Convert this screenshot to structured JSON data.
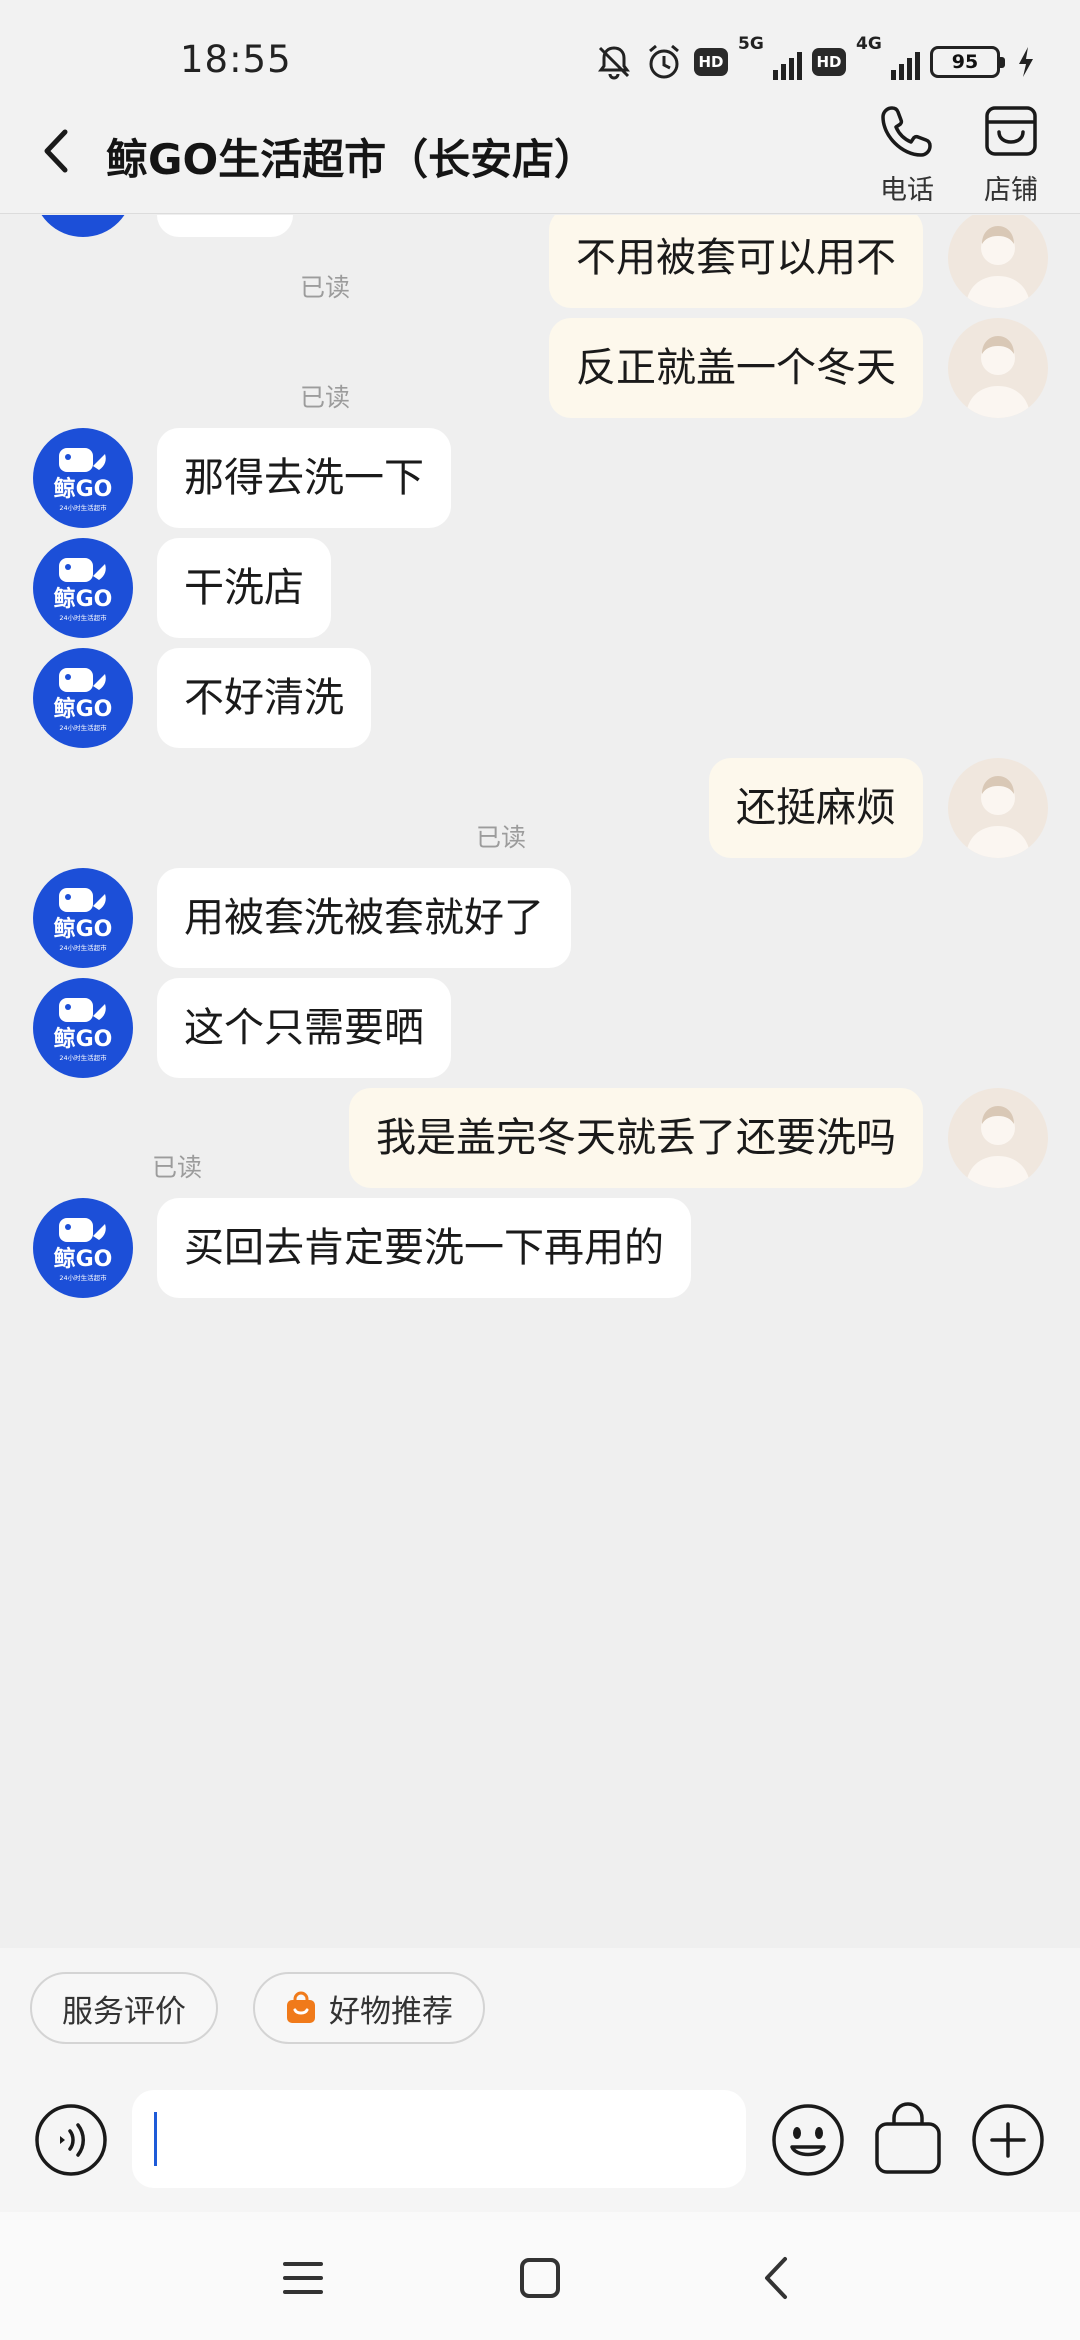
{
  "status_bar": {
    "time": "18:55",
    "network_1": "5G",
    "network_2": "4G",
    "hd_label": "HD",
    "battery": "95",
    "icons": [
      "mute-icon",
      "alarm-icon",
      "hd-icon",
      "signal-icon",
      "battery-icon",
      "charging-icon"
    ]
  },
  "header": {
    "title": "鲸GO生活超市（长安店）",
    "phone_label": "电话",
    "store_label": "店铺"
  },
  "avatar": {
    "bot_logo": "鲸GO",
    "bot_tagline": "24小时生活超市"
  },
  "messages": [
    {
      "side": "out",
      "text": "不用被套可以用不",
      "read": "已读"
    },
    {
      "side": "out",
      "text": "反正就盖一个冬天",
      "read": "已读"
    },
    {
      "side": "in",
      "text": "那得去洗一下"
    },
    {
      "side": "in",
      "text": "干洗店"
    },
    {
      "side": "in",
      "text": "不好清洗"
    },
    {
      "side": "out",
      "text": "还挺麻烦",
      "read": "已读"
    },
    {
      "side": "in",
      "text": "用被套洗被套就好了"
    },
    {
      "side": "in",
      "text": "这个只需要晒"
    },
    {
      "side": "out",
      "text": "我是盖完冬天就丢了还要洗吗",
      "read": "已读"
    },
    {
      "side": "in",
      "text": "买回去肯定要洗一下再用的"
    }
  ],
  "quick_actions": {
    "review": "服务评价",
    "recommend": "好物推荐"
  },
  "input": {
    "value": "",
    "placeholder": ""
  },
  "colors": {
    "bot_avatar": "#1c4fd8",
    "outgoing_bubble": "#fdf8ec",
    "incoming_bubble": "#ffffff",
    "background": "#efefef",
    "recommend_bag": "#f07a1a",
    "battery_fill": "#37c23b"
  }
}
